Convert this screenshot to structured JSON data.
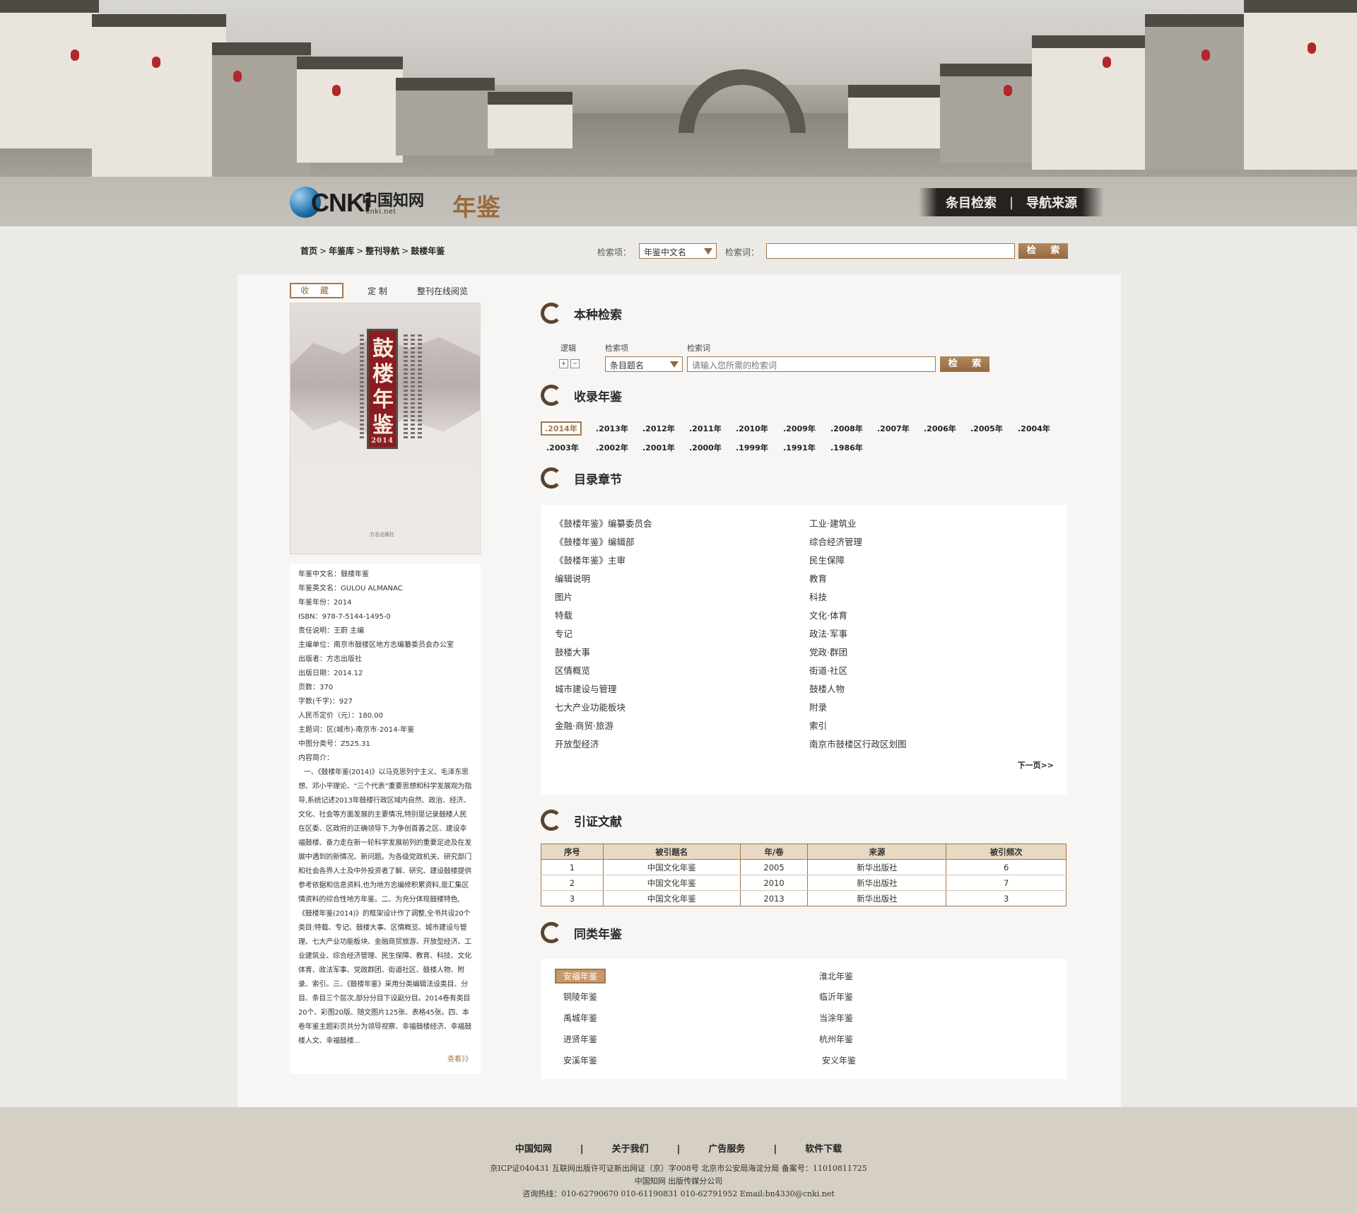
{
  "header": {
    "logo_cnki": "CNKi",
    "logo_cn": "中国知网",
    "logo_url": "cnki.net",
    "logo_product": "年鉴",
    "nav": [
      "条目检索",
      "|",
      "导航来源"
    ]
  },
  "breadcrumb": [
    "首页",
    "年鉴库",
    "整刊导航",
    "鼓楼年鉴"
  ],
  "top_search": {
    "field_label": "检索项：",
    "field_value": "年鉴中文名",
    "term_label": "检索词：",
    "term_value": "",
    "button": "检 索"
  },
  "left": {
    "tabs": [
      "收 藏",
      "定 制",
      "整刊在线阅览"
    ],
    "cover": {
      "title": "鼓楼年鉴",
      "year": "2014",
      "publisher": "方志出版社"
    },
    "info": [
      "年鉴中文名：鼓楼年鉴",
      "年鉴英文名：GULOU ALMANAC",
      "年鉴年份：2014",
      "ISBN：978-7-5144-1495-0",
      "责任说明：王蔚 主编",
      "主编单位：南京市鼓楼区地方志编纂委员会办公室",
      "出版者：方志出版社",
      "出版日期：2014.12",
      "页数：370",
      "字数(千字)：927",
      "人民币定价（元）：180.00",
      "主题词：区(城市)-南京市-2014-年鉴",
      "中图分类号：Z525.31",
      "内容简介："
    ],
    "description": "一、《鼓楼年鉴(2014)》以马克思列宁主义、毛泽东思想、邓小平理论、“三个代表”重要思想和科学发展观为指导,系统记述2013年鼓楼行政区域内自然、政治、经济、文化、社会等方面发展的主要情况,特别是记录鼓楼人民在区委、区政府的正确领导下,为争创首善之区、建设幸福鼓楼、奋力走在新一轮科学发展前列的重要足迹及在发展中遇到的新情况、新问题。为各级党政机关、研究部门和社会各界人士及中外投资者了解、研究、建设鼓楼提供参考依据和信息资料,也为地方志编修积累资料,是汇集区情资料的综合性地方年鉴。二、为充分体现鼓楼特色,《鼓楼年鉴(2014)》的框架设计作了调整,全书共设20个类目:特载、专记、鼓楼大事、区情概览、城市建设与管理、七大产业功能板块、金融商贸旅游、开放型经济、工业建筑业、综合经济管理、民生保障、教育、科技、文化体育、政法军事、党政群团、街道社区、鼓楼人物、附录、索引。三、《鼓楼年鉴》采用分类编辑法设类目、分目、条目三个层次,部分分目下设副分目。2014卷有类目20个、彩图20版、随文图片125张、表格45张。四、本卷年鉴主题彩页共分为领导视察、幸福鼓楼经济、幸福鼓楼人文、幸福鼓楼...",
    "more": "查看》》"
  },
  "sections": {
    "search": "本种检索",
    "years": "收录年鉴",
    "toc": "目录章节",
    "cite": "引证文献",
    "similar": "同类年鉴"
  },
  "inner_search": {
    "logic_label": "逻辑",
    "field_label": "检索项",
    "term_label": "检索词",
    "field_value": "条目题名",
    "term_placeholder": "请输入您所需的检索词",
    "button": "检 索"
  },
  "years": [
    ".2014年",
    ".2013年",
    ".2012年",
    ".2011年",
    ".2010年",
    ".2009年",
    ".2008年",
    ".2007年",
    ".2006年",
    ".2005年",
    ".2004年",
    ".2003年",
    ".2002年",
    ".2001年",
    ".2000年",
    ".1999年",
    ".1991年",
    ".1986年"
  ],
  "toc": {
    "left": [
      "《鼓楼年鉴》编纂委员会",
      "《鼓楼年鉴》编辑部",
      "《鼓楼年鉴》主审",
      "编辑说明",
      "图片",
      "特载",
      "专记",
      "鼓楼大事",
      "区情概览",
      "城市建设与管理",
      "七大产业功能板块",
      "金融·商贸·旅游",
      "开放型经济"
    ],
    "right": [
      "工业·建筑业",
      "综合经济管理",
      "民生保障",
      "教育",
      "科技",
      "文化·体育",
      "政法·军事",
      "党政·群团",
      "街道·社区",
      "鼓楼人物",
      "附录",
      "索引",
      "南京市鼓楼区行政区划图"
    ],
    "next": "下一页>>"
  },
  "cite": {
    "headers": [
      "序号",
      "被引题名",
      "年/卷",
      "来源",
      "被引频次"
    ],
    "rows": [
      [
        "1",
        "中国文化年鉴",
        "2005",
        "新华出版社",
        "6"
      ],
      [
        "2",
        "中国文化年鉴",
        "2010",
        "新华出版社",
        "7"
      ],
      [
        "3",
        "中国文化年鉴",
        "2013",
        "新华出版社",
        "3"
      ]
    ]
  },
  "similar": {
    "left": [
      "安福年鉴",
      "铜陵年鉴",
      "禹城年鉴",
      "进贤年鉴",
      "安溪年鉴"
    ],
    "right": [
      "淮北年鉴",
      "临沂年鉴",
      "当涂年鉴",
      "杭州年鉴",
      "安义年鉴"
    ]
  },
  "footer": {
    "links": [
      "中国知网",
      "|",
      "关于我们",
      "|",
      "广告服务",
      "|",
      "软件下载"
    ],
    "line1": "京ICP证040431  互联网出版许可证新出网证（京）字008号  北京市公安局海淀分局  备案号：11010811725",
    "line2": "中国知网  出版传媒分公司",
    "line3": "咨询热线：010-62790670    010-61190831    010-62791952   Email:bn4330@cnki.net"
  },
  "colors": {
    "accent": "#a2774c",
    "accent_dark": "#5a4431",
    "footer_bg": "#d5cfc4",
    "page_bg": "#ebeae7"
  }
}
